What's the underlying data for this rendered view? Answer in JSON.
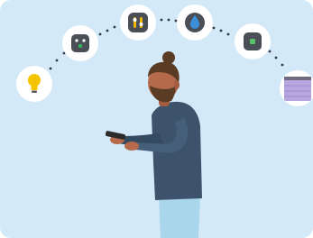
{
  "scene": {
    "background_color": "#d4e9f8",
    "arc_dot_color": "#2f3a46",
    "device_icons": [
      {
        "name": "lightbulb-icon",
        "accent": "#f5c400",
        "badge_bg": "#ffffff"
      },
      {
        "name": "smart-plug-icon",
        "accent": "#2fb553",
        "badge_bg": "#ffffff"
      },
      {
        "name": "thermostat-icon",
        "accent": "#f2b705",
        "badge_bg": "#ffffff"
      },
      {
        "name": "water-leak-sensor-icon",
        "accent": "#3b8fd8",
        "badge_bg": "#ffffff"
      },
      {
        "name": "motion-sensor-icon",
        "accent": "#56c36b",
        "badge_bg": "#ffffff"
      },
      {
        "name": "window-shade-icon",
        "accent": "#b8a6e0",
        "badge_bg": "#ffffff"
      }
    ],
    "person": {
      "shirt_color": "#3d536b",
      "pants_color": "#a9d6ea",
      "skin_color": "#b56a4c",
      "hair_color": "#5a3b23",
      "phone_color": "#2b2b2b"
    }
  }
}
